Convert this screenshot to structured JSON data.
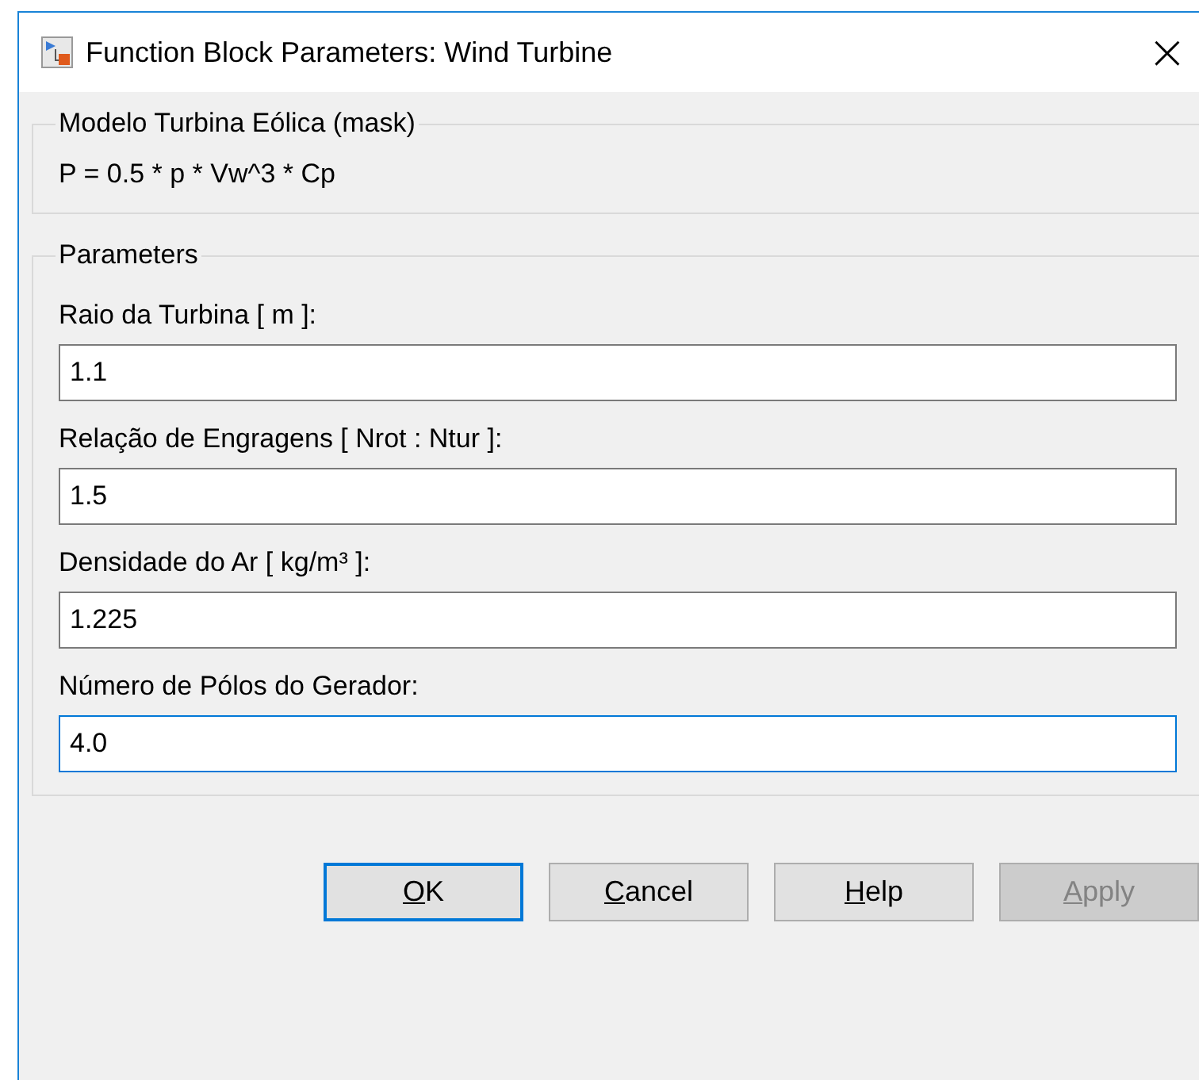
{
  "window": {
    "title": "Function Block Parameters: Wind Turbine",
    "close": "×"
  },
  "description": {
    "title": "Modelo Turbina Eólica (mask)",
    "text": "P = 0.5 * p * Vw^3 * Cp"
  },
  "parameters": {
    "title": "Parameters",
    "fields": [
      {
        "label": "Raio da Turbina [ m ]:",
        "value": "1.1",
        "focused": false
      },
      {
        "label": "Relação de Engragens [ Nrot : Ntur ]:",
        "value": "1.5",
        "focused": false
      },
      {
        "label": "Densidade do Ar [ kg/m³ ]:",
        "value": "1.225",
        "focused": false
      },
      {
        "label": "Número de Pólos do Gerador:",
        "value": "4.0",
        "focused": true
      }
    ]
  },
  "buttons": [
    {
      "label": "OK",
      "mnemonic_first_letter": true,
      "default": true,
      "disabled": false
    },
    {
      "label": "Cancel",
      "mnemonic_first_letter": true,
      "default": false,
      "disabled": false
    },
    {
      "label": "Help",
      "mnemonic_first_letter": true,
      "default": false,
      "disabled": false
    },
    {
      "label": "Apply",
      "mnemonic_first_letter": true,
      "default": false,
      "disabled": true
    }
  ]
}
